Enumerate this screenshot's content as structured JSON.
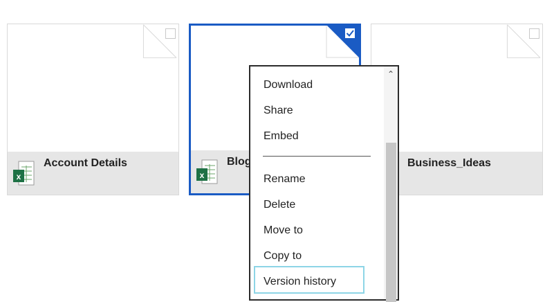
{
  "files": [
    {
      "name": "Account Details",
      "type": "excel-icon",
      "selected": false
    },
    {
      "name": "Blog",
      "type": "excel-icon",
      "selected": true
    },
    {
      "name": "Business_Ideas",
      "type": "none",
      "selected": false
    }
  ],
  "context_menu": {
    "items": [
      "Download",
      "Share",
      "Embed",
      "Rename",
      "Delete",
      "Move to",
      "Copy to",
      "Version history"
    ],
    "focused_item": "Version history"
  },
  "colors": {
    "selection_blue": "#1a5bc4",
    "excel_green": "#1e7145",
    "focus_outline": "#8dd5e6"
  }
}
